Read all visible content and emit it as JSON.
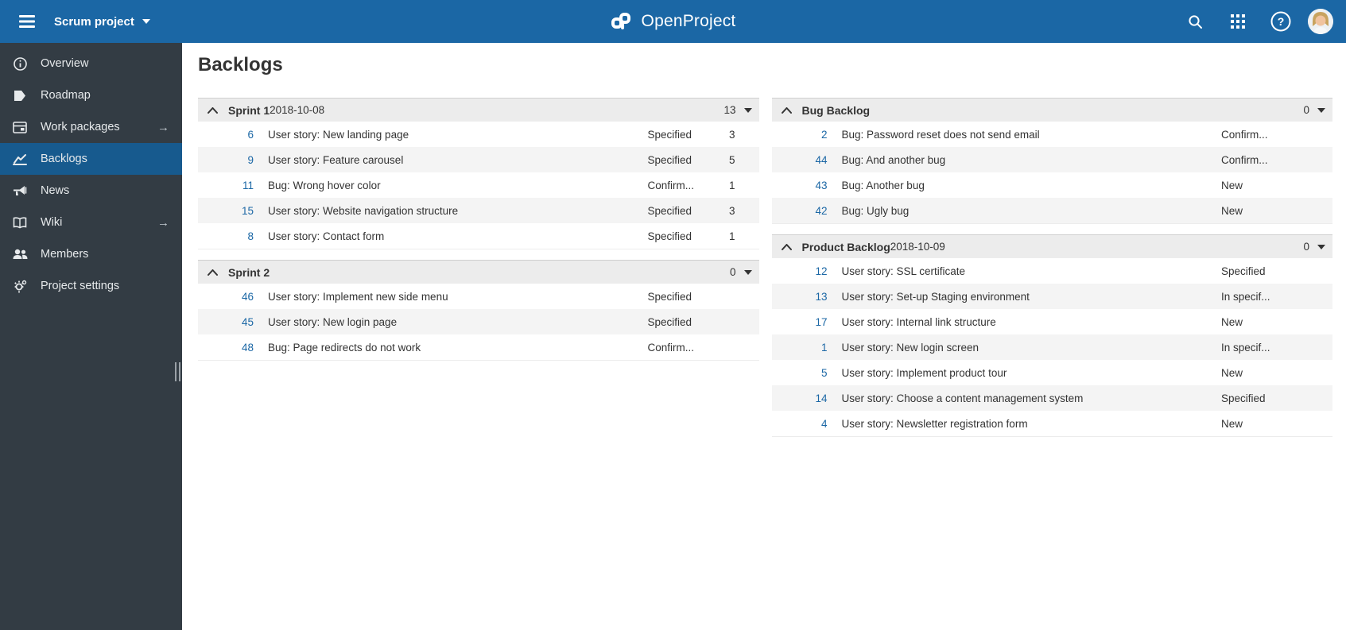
{
  "colors": {
    "accent": "#1b67a5",
    "sidebar_bg": "#333c44",
    "sidebar_selected": "#175a8e",
    "header_row_bg": "#ececec",
    "alt_row_bg": "#f4f4f4"
  },
  "topbar": {
    "project_name": "Scrum project",
    "logo_text": "OpenProject",
    "icons": [
      "menu-icon",
      "search-icon",
      "grid-icon",
      "help-icon",
      "avatar"
    ]
  },
  "sidebar": {
    "items": [
      {
        "label": "Overview",
        "icon": "info-icon",
        "selected": false,
        "has_arrow": false
      },
      {
        "label": "Roadmap",
        "icon": "roadmap-icon",
        "selected": false,
        "has_arrow": false
      },
      {
        "label": "Work packages",
        "icon": "work-packages-icon",
        "selected": false,
        "has_arrow": true
      },
      {
        "label": "Backlogs",
        "icon": "backlogs-icon",
        "selected": true,
        "has_arrow": false
      },
      {
        "label": "News",
        "icon": "news-icon",
        "selected": false,
        "has_arrow": false
      },
      {
        "label": "Wiki",
        "icon": "wiki-icon",
        "selected": false,
        "has_arrow": true
      },
      {
        "label": "Members",
        "icon": "members-icon",
        "selected": false,
        "has_arrow": false
      },
      {
        "label": "Project settings",
        "icon": "settings-icon",
        "selected": false,
        "has_arrow": false
      }
    ]
  },
  "page": {
    "title": "Backlogs"
  },
  "backlogs": {
    "left": [
      {
        "name": "Sprint 1",
        "date": "2018-10-08",
        "count": "13",
        "rows": [
          {
            "id": "6",
            "title": "User story: New landing page",
            "status": "Specified",
            "points": "3"
          },
          {
            "id": "9",
            "title": "User story: Feature carousel",
            "status": "Specified",
            "points": "5"
          },
          {
            "id": "11",
            "title": "Bug: Wrong hover color",
            "status": "Confirm...",
            "points": "1"
          },
          {
            "id": "15",
            "title": "User story: Website navigation structure",
            "status": "Specified",
            "points": "3"
          },
          {
            "id": "8",
            "title": "User story: Contact form",
            "status": "Specified",
            "points": "1"
          }
        ]
      },
      {
        "name": "Sprint 2",
        "date": "",
        "count": "0",
        "rows": [
          {
            "id": "46",
            "title": "User story: Implement new side menu",
            "status": "Specified",
            "points": ""
          },
          {
            "id": "45",
            "title": "User story: New login page",
            "status": "Specified",
            "points": ""
          },
          {
            "id": "48",
            "title": "Bug: Page redirects do not work",
            "status": "Confirm...",
            "points": ""
          }
        ]
      }
    ],
    "right": [
      {
        "name": "Bug Backlog",
        "date": "",
        "count": "0",
        "rows": [
          {
            "id": "2",
            "title": "Bug: Password reset does not send email",
            "status": "Confirm...",
            "points": ""
          },
          {
            "id": "44",
            "title": "Bug: And another bug",
            "status": "Confirm...",
            "points": ""
          },
          {
            "id": "43",
            "title": "Bug: Another bug",
            "status": "New",
            "points": ""
          },
          {
            "id": "42",
            "title": "Bug: Ugly bug",
            "status": "New",
            "points": ""
          }
        ]
      },
      {
        "name": "Product Backlog",
        "date": "2018-10-09",
        "count": "0",
        "rows": [
          {
            "id": "12",
            "title": "User story: SSL certificate",
            "status": "Specified",
            "points": ""
          },
          {
            "id": "13",
            "title": "User story: Set-up Staging environment",
            "status": "In specif...",
            "points": ""
          },
          {
            "id": "17",
            "title": "User story: Internal link structure",
            "status": "New",
            "points": ""
          },
          {
            "id": "1",
            "title": "User story: New login screen",
            "status": "In specif...",
            "points": ""
          },
          {
            "id": "5",
            "title": "User story: Implement product tour",
            "status": "New",
            "points": ""
          },
          {
            "id": "14",
            "title": "User story: Choose a content management system",
            "status": "Specified",
            "points": ""
          },
          {
            "id": "4",
            "title": "User story: Newsletter registration form",
            "status": "New",
            "points": ""
          }
        ]
      }
    ]
  }
}
